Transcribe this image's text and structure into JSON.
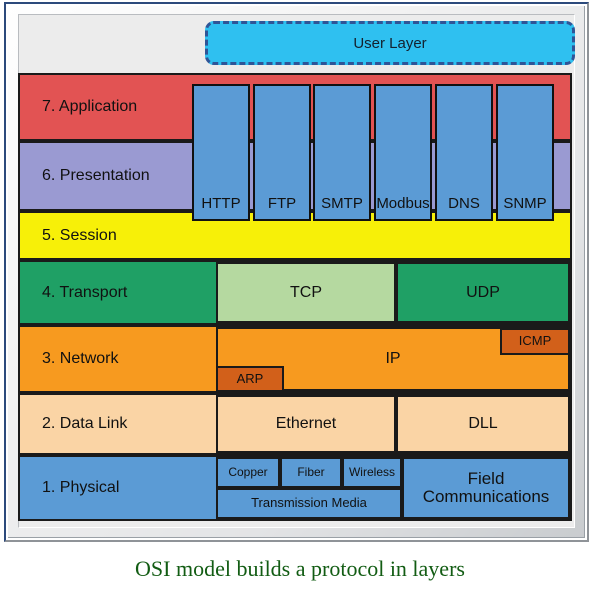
{
  "diagram": {
    "caption": "OSI model builds a protocol in layers",
    "user_layer": {
      "label": "User Layer",
      "fill": "#2fc0f0",
      "border": "#2f5597"
    },
    "layers": [
      {
        "label": "7. Application",
        "fill": "#e25353"
      },
      {
        "label": "6. Presentation",
        "fill": "#9a9ad2"
      },
      {
        "label": "5. Session",
        "fill": "#f7f008"
      },
      {
        "label": "4. Transport",
        "fill": "#1fa065"
      },
      {
        "label": "3. Network",
        "fill": "#f79a1f"
      },
      {
        "label": "2. Data Link",
        "fill": "#fad4a5"
      },
      {
        "label": "1. Physical",
        "fill": "#5b9bd5"
      }
    ],
    "protocols": [
      {
        "label": "HTTP"
      },
      {
        "label": "FTP"
      },
      {
        "label": "SMTP"
      },
      {
        "label": "Modbus"
      },
      {
        "label": "DNS"
      },
      {
        "label": "SNMP"
      }
    ],
    "transport": [
      {
        "label": "TCP",
        "fill": "#b5d9a0"
      },
      {
        "label": "UDP",
        "fill": "#1fa065"
      }
    ],
    "network": [
      {
        "label": "IP",
        "fill": "#f79a1f"
      },
      {
        "label": "ICMP",
        "fill": "#d2601a"
      },
      {
        "label": "ARP",
        "fill": "#d2601a"
      }
    ],
    "datalink": [
      {
        "label": "Ethernet",
        "fill": "#fad4a5"
      },
      {
        "label": "DLL",
        "fill": "#fad4a5"
      }
    ],
    "physical": [
      {
        "label": "Copper",
        "fill": "#5b9bd5"
      },
      {
        "label": "Fiber",
        "fill": "#5b9bd5"
      },
      {
        "label": "Wireless",
        "fill": "#5b9bd5"
      },
      {
        "label": "Transmission Media",
        "fill": "#5b9bd5"
      },
      {
        "label": "Field\nCommunications",
        "fill": "#5b9bd5"
      }
    ]
  }
}
